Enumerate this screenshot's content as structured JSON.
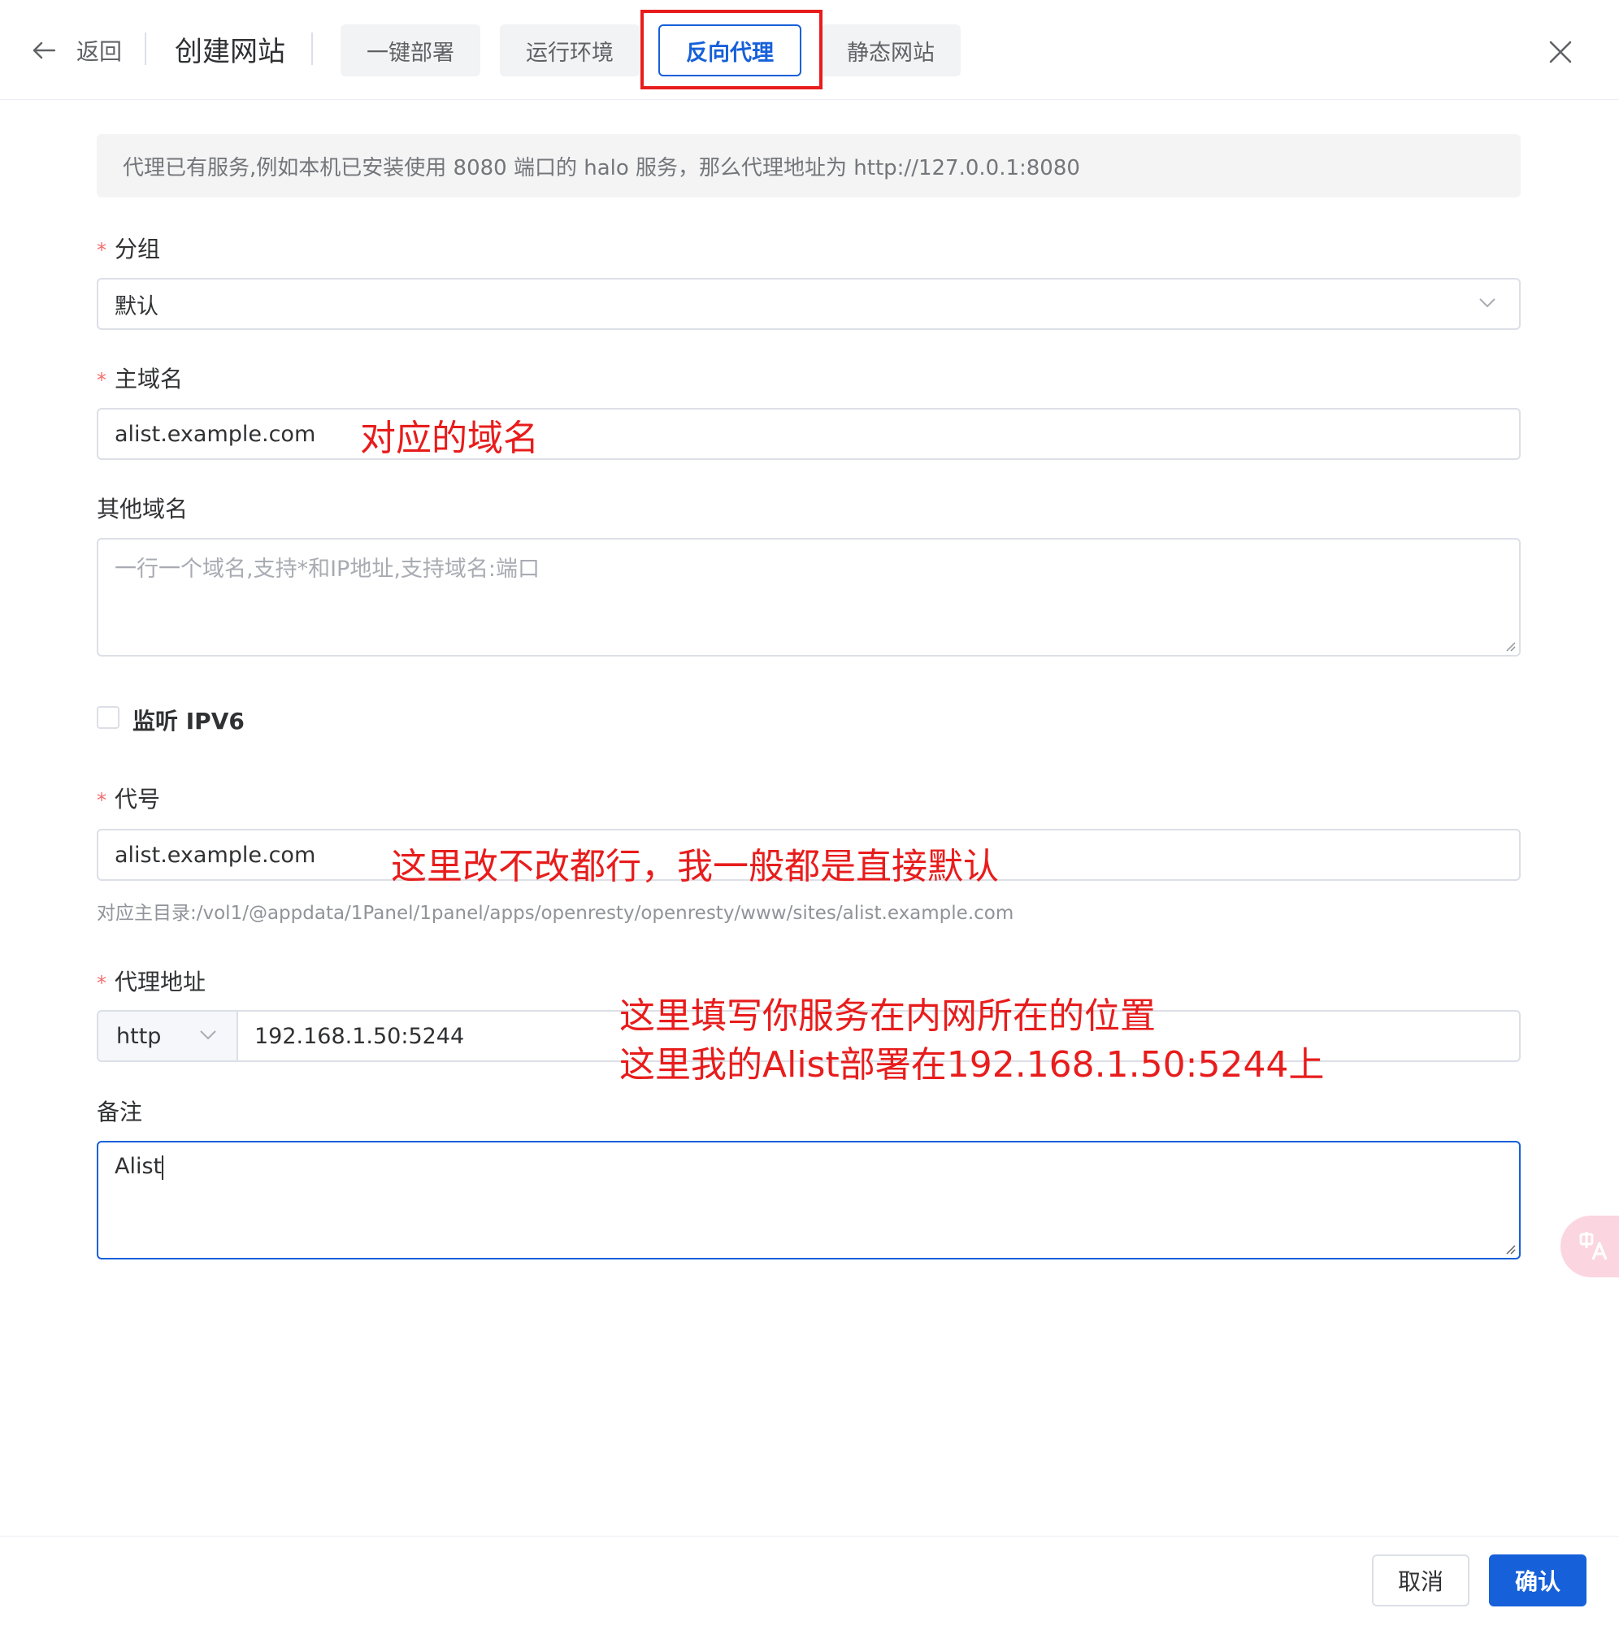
{
  "header": {
    "back_label": "返回",
    "title": "创建网站",
    "tabs": [
      {
        "label": "一键部署"
      },
      {
        "label": "运行环境"
      },
      {
        "label": "反向代理",
        "active": true
      },
      {
        "label": "静态网站"
      }
    ]
  },
  "alert": {
    "text": "代理已有服务,例如本机已安装使用 8080 端口的 halo 服务，那么代理地址为 http://127.0.0.1:8080"
  },
  "form": {
    "group": {
      "label": "分组",
      "required": true,
      "value": "默认"
    },
    "primary_domain": {
      "label": "主域名",
      "required": true,
      "value": "alist.example.com"
    },
    "other_domains": {
      "label": "其他域名",
      "placeholder": "一行一个域名,支持*和IP地址,支持域名:端口",
      "value": ""
    },
    "ipv6": {
      "label": "监听 IPV6",
      "checked": false
    },
    "alias": {
      "label": "代号",
      "required": true,
      "value": "alist.example.com",
      "hint": "对应主目录:/vol1/@appdata/1Panel/1panel/apps/openresty/openresty/www/sites/alist.example.com"
    },
    "proxy_address": {
      "label": "代理地址",
      "required": true,
      "protocol": "http",
      "value": "192.168.1.50:5244"
    },
    "remark": {
      "label": "备注",
      "value": "Alist"
    }
  },
  "annotations": {
    "domain_note": "对应的域名",
    "alias_note": "这里改不改都行，我一般都是直接默认",
    "proxy_note_line1": "这里填写你服务在内网所在的位置",
    "proxy_note_line2": "这里我的Alist部署在192.168.1.50:5244上"
  },
  "footer": {
    "cancel_label": "取消",
    "confirm_label": "确认"
  },
  "colors": {
    "primary": "#1660d9",
    "annotation": "#e81c1c",
    "required": "#f56c6c"
  },
  "icons": {
    "back": "arrow-left-icon",
    "close": "close-icon",
    "dropdown": "chevron-down-icon",
    "translate": "translate-icon"
  }
}
